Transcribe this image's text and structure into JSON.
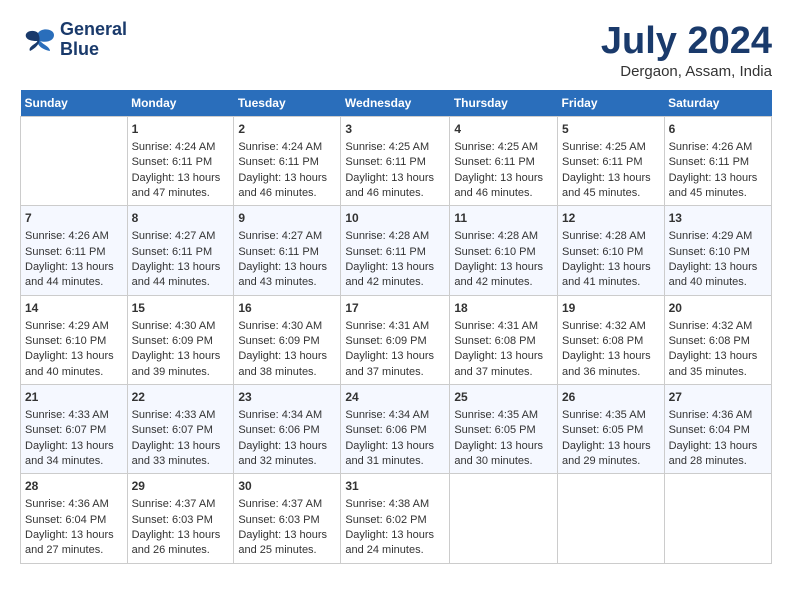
{
  "header": {
    "logo_line1": "General",
    "logo_line2": "Blue",
    "month_year": "July 2024",
    "location": "Dergaon, Assam, India"
  },
  "days_of_week": [
    "Sunday",
    "Monday",
    "Tuesday",
    "Wednesday",
    "Thursday",
    "Friday",
    "Saturday"
  ],
  "weeks": [
    [
      {
        "day": "",
        "sunrise": "",
        "sunset": "",
        "daylight": ""
      },
      {
        "day": "1",
        "sunrise": "Sunrise: 4:24 AM",
        "sunset": "Sunset: 6:11 PM",
        "daylight": "Daylight: 13 hours and 47 minutes."
      },
      {
        "day": "2",
        "sunrise": "Sunrise: 4:24 AM",
        "sunset": "Sunset: 6:11 PM",
        "daylight": "Daylight: 13 hours and 46 minutes."
      },
      {
        "day": "3",
        "sunrise": "Sunrise: 4:25 AM",
        "sunset": "Sunset: 6:11 PM",
        "daylight": "Daylight: 13 hours and 46 minutes."
      },
      {
        "day": "4",
        "sunrise": "Sunrise: 4:25 AM",
        "sunset": "Sunset: 6:11 PM",
        "daylight": "Daylight: 13 hours and 46 minutes."
      },
      {
        "day": "5",
        "sunrise": "Sunrise: 4:25 AM",
        "sunset": "Sunset: 6:11 PM",
        "daylight": "Daylight: 13 hours and 45 minutes."
      },
      {
        "day": "6",
        "sunrise": "Sunrise: 4:26 AM",
        "sunset": "Sunset: 6:11 PM",
        "daylight": "Daylight: 13 hours and 45 minutes."
      }
    ],
    [
      {
        "day": "7",
        "sunrise": "Sunrise: 4:26 AM",
        "sunset": "Sunset: 6:11 PM",
        "daylight": "Daylight: 13 hours and 44 minutes."
      },
      {
        "day": "8",
        "sunrise": "Sunrise: 4:27 AM",
        "sunset": "Sunset: 6:11 PM",
        "daylight": "Daylight: 13 hours and 44 minutes."
      },
      {
        "day": "9",
        "sunrise": "Sunrise: 4:27 AM",
        "sunset": "Sunset: 6:11 PM",
        "daylight": "Daylight: 13 hours and 43 minutes."
      },
      {
        "day": "10",
        "sunrise": "Sunrise: 4:28 AM",
        "sunset": "Sunset: 6:11 PM",
        "daylight": "Daylight: 13 hours and 42 minutes."
      },
      {
        "day": "11",
        "sunrise": "Sunrise: 4:28 AM",
        "sunset": "Sunset: 6:10 PM",
        "daylight": "Daylight: 13 hours and 42 minutes."
      },
      {
        "day": "12",
        "sunrise": "Sunrise: 4:28 AM",
        "sunset": "Sunset: 6:10 PM",
        "daylight": "Daylight: 13 hours and 41 minutes."
      },
      {
        "day": "13",
        "sunrise": "Sunrise: 4:29 AM",
        "sunset": "Sunset: 6:10 PM",
        "daylight": "Daylight: 13 hours and 40 minutes."
      }
    ],
    [
      {
        "day": "14",
        "sunrise": "Sunrise: 4:29 AM",
        "sunset": "Sunset: 6:10 PM",
        "daylight": "Daylight: 13 hours and 40 minutes."
      },
      {
        "day": "15",
        "sunrise": "Sunrise: 4:30 AM",
        "sunset": "Sunset: 6:09 PM",
        "daylight": "Daylight: 13 hours and 39 minutes."
      },
      {
        "day": "16",
        "sunrise": "Sunrise: 4:30 AM",
        "sunset": "Sunset: 6:09 PM",
        "daylight": "Daylight: 13 hours and 38 minutes."
      },
      {
        "day": "17",
        "sunrise": "Sunrise: 4:31 AM",
        "sunset": "Sunset: 6:09 PM",
        "daylight": "Daylight: 13 hours and 37 minutes."
      },
      {
        "day": "18",
        "sunrise": "Sunrise: 4:31 AM",
        "sunset": "Sunset: 6:08 PM",
        "daylight": "Daylight: 13 hours and 37 minutes."
      },
      {
        "day": "19",
        "sunrise": "Sunrise: 4:32 AM",
        "sunset": "Sunset: 6:08 PM",
        "daylight": "Daylight: 13 hours and 36 minutes."
      },
      {
        "day": "20",
        "sunrise": "Sunrise: 4:32 AM",
        "sunset": "Sunset: 6:08 PM",
        "daylight": "Daylight: 13 hours and 35 minutes."
      }
    ],
    [
      {
        "day": "21",
        "sunrise": "Sunrise: 4:33 AM",
        "sunset": "Sunset: 6:07 PM",
        "daylight": "Daylight: 13 hours and 34 minutes."
      },
      {
        "day": "22",
        "sunrise": "Sunrise: 4:33 AM",
        "sunset": "Sunset: 6:07 PM",
        "daylight": "Daylight: 13 hours and 33 minutes."
      },
      {
        "day": "23",
        "sunrise": "Sunrise: 4:34 AM",
        "sunset": "Sunset: 6:06 PM",
        "daylight": "Daylight: 13 hours and 32 minutes."
      },
      {
        "day": "24",
        "sunrise": "Sunrise: 4:34 AM",
        "sunset": "Sunset: 6:06 PM",
        "daylight": "Daylight: 13 hours and 31 minutes."
      },
      {
        "day": "25",
        "sunrise": "Sunrise: 4:35 AM",
        "sunset": "Sunset: 6:05 PM",
        "daylight": "Daylight: 13 hours and 30 minutes."
      },
      {
        "day": "26",
        "sunrise": "Sunrise: 4:35 AM",
        "sunset": "Sunset: 6:05 PM",
        "daylight": "Daylight: 13 hours and 29 minutes."
      },
      {
        "day": "27",
        "sunrise": "Sunrise: 4:36 AM",
        "sunset": "Sunset: 6:04 PM",
        "daylight": "Daylight: 13 hours and 28 minutes."
      }
    ],
    [
      {
        "day": "28",
        "sunrise": "Sunrise: 4:36 AM",
        "sunset": "Sunset: 6:04 PM",
        "daylight": "Daylight: 13 hours and 27 minutes."
      },
      {
        "day": "29",
        "sunrise": "Sunrise: 4:37 AM",
        "sunset": "Sunset: 6:03 PM",
        "daylight": "Daylight: 13 hours and 26 minutes."
      },
      {
        "day": "30",
        "sunrise": "Sunrise: 4:37 AM",
        "sunset": "Sunset: 6:03 PM",
        "daylight": "Daylight: 13 hours and 25 minutes."
      },
      {
        "day": "31",
        "sunrise": "Sunrise: 4:38 AM",
        "sunset": "Sunset: 6:02 PM",
        "daylight": "Daylight: 13 hours and 24 minutes."
      },
      {
        "day": "",
        "sunrise": "",
        "sunset": "",
        "daylight": ""
      },
      {
        "day": "",
        "sunrise": "",
        "sunset": "",
        "daylight": ""
      },
      {
        "day": "",
        "sunrise": "",
        "sunset": "",
        "daylight": ""
      }
    ]
  ]
}
